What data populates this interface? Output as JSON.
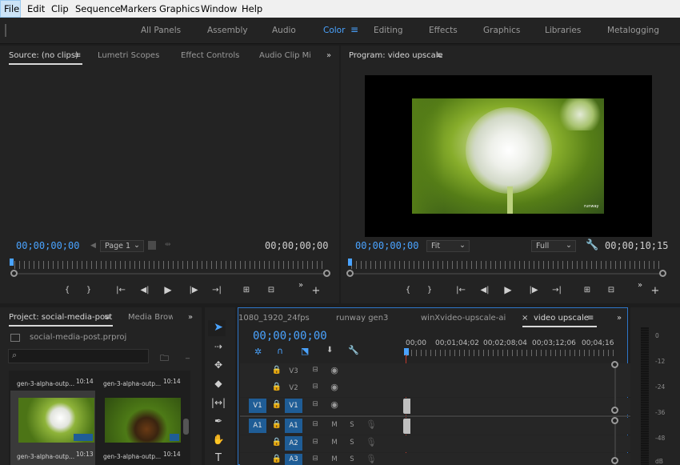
{
  "menu": {
    "items": [
      "File",
      "Edit",
      "Clip",
      "Sequence",
      "Markers",
      "Graphics",
      "Window",
      "Help"
    ]
  },
  "workspaces": {
    "items": [
      "All Panels",
      "Assembly",
      "Audio",
      "Color",
      "Editing",
      "Effects",
      "Graphics",
      "Libraries",
      "Metalogging"
    ],
    "active": "Color"
  },
  "source": {
    "tabs": [
      "Source: (no clips)",
      "Lumetri Scopes",
      "Effect Controls",
      "Audio Clip Mixi"
    ],
    "timecode_in": "00;00;00;00",
    "page": "Page 1",
    "timecode_out": "00;00;00;00"
  },
  "program": {
    "title": "Program: video upscale",
    "timecode": "00;00;00;00",
    "fit": "Fit",
    "quality": "Full",
    "duration": "00;00;10;15",
    "watermark": "runway"
  },
  "transport": {
    "mark_in": "{",
    "mark_out": "}"
  },
  "project": {
    "tabs": [
      "Project: social-media-post",
      "Media Brows"
    ],
    "file": "social-media-post.prproj",
    "items": [
      {
        "name": "gen-3-alpha-outp...",
        "duration": "10:14"
      },
      {
        "name": "gen-3-alpha-outp...",
        "duration": "10:14"
      },
      {
        "name": "gen-3-alpha-outp...",
        "duration": "10:13"
      },
      {
        "name": "gen-3-alpha-outp...",
        "duration": "10:14"
      }
    ]
  },
  "timeline": {
    "tabs": [
      "1080_1920_24fps",
      "runway gen3",
      "winXvideo-upscale-ai",
      "video upscale"
    ],
    "timecode": "00;00;00;00",
    "ruler": [
      "00;00",
      "00;01;04;02",
      "00;02;08;04",
      "00;03;12;06",
      "00;04;16"
    ],
    "tracks": [
      {
        "name": "V3"
      },
      {
        "name": "V2"
      },
      {
        "name": "V1",
        "src": "V1"
      },
      {
        "name": "A1",
        "src": "A1"
      },
      {
        "name": "A2"
      },
      {
        "name": "A3"
      }
    ],
    "mute_label": "M",
    "solo_label": "S"
  },
  "meter": {
    "labels": [
      "0",
      "-12",
      "-24",
      "-36",
      "-48",
      "dB"
    ]
  },
  "colors": {
    "accent": "#4aa3ff",
    "track_btn": "#1f5d96",
    "panel": "#232323",
    "background": "#1d1d1d"
  }
}
